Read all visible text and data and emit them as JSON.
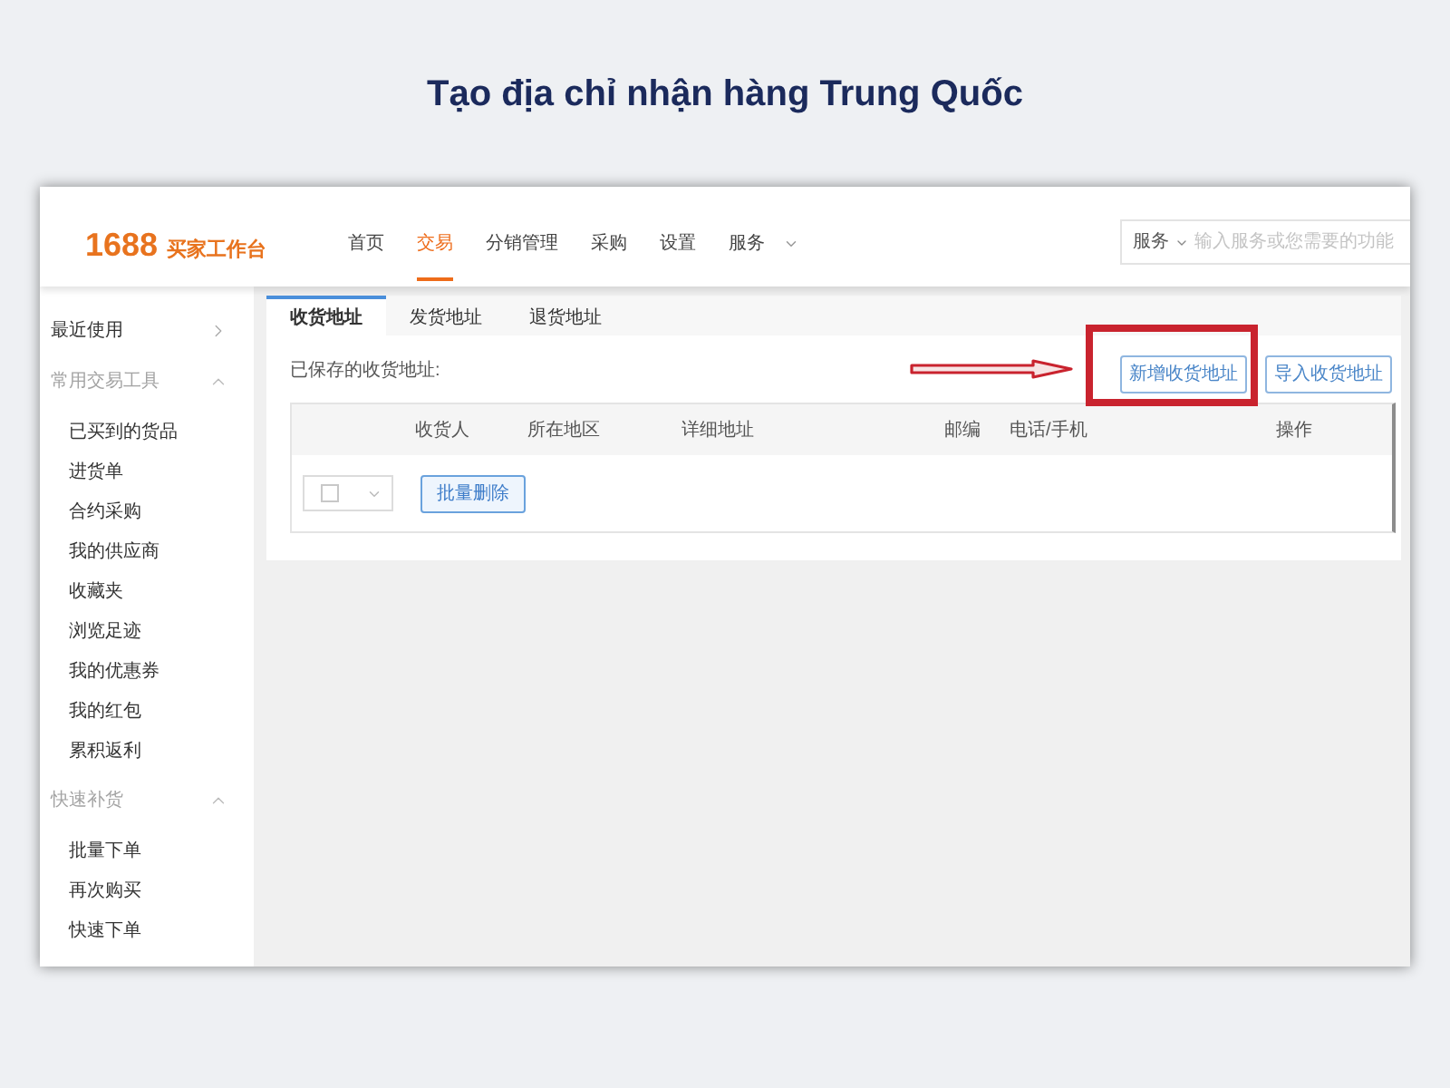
{
  "heading": "Tạo địa chỉ nhận hàng Trung Quốc",
  "header": {
    "logo_number": "1688",
    "logo_text": "买家工作台",
    "nav": [
      {
        "label": "首页",
        "selected": false,
        "kind": "link"
      },
      {
        "label": "交易",
        "selected": true,
        "kind": "link"
      },
      {
        "label": "分销管理",
        "selected": false,
        "kind": "link"
      },
      {
        "label": "采购",
        "selected": false,
        "kind": "link"
      },
      {
        "label": "设置",
        "selected": false,
        "kind": "link"
      },
      {
        "label": "服务",
        "selected": false,
        "kind": "dropdown"
      }
    ],
    "search": {
      "scope": "服务",
      "placeholder": "输入服务或您需要的功能"
    }
  },
  "sidebar": {
    "sections": [
      {
        "label": "最近使用",
        "kind": "link"
      },
      {
        "label": "常用交易工具",
        "kind": "group",
        "expanded": true,
        "children": [
          {
            "label": "已买到的货品"
          },
          {
            "label": "进货单"
          },
          {
            "label": "合约采购"
          },
          {
            "label": "我的供应商"
          },
          {
            "label": "收藏夹"
          },
          {
            "label": "浏览足迹"
          },
          {
            "label": "我的优惠券"
          },
          {
            "label": "我的红包"
          },
          {
            "label": "累积返利"
          }
        ]
      },
      {
        "label": "快速补货",
        "kind": "group",
        "expanded": true,
        "children": [
          {
            "label": "批量下单"
          },
          {
            "label": "再次购买"
          },
          {
            "label": "快速下单"
          }
        ]
      }
    ]
  },
  "tabs": [
    {
      "label": "收货地址",
      "selected": true
    },
    {
      "label": "发货地址",
      "selected": false
    },
    {
      "label": "退货地址",
      "selected": false
    }
  ],
  "saved_label": "已保存的收货地址:",
  "actions": [
    {
      "label": "新增收货地址",
      "highlighted": true
    },
    {
      "label": "导入收货地址",
      "highlighted": false
    }
  ],
  "table": {
    "columns": [
      "收货人",
      "所在地区",
      "详细地址",
      "邮编",
      "电话/手机",
      "操作"
    ],
    "select_all": {
      "checked": false
    },
    "bulk_action": "批量删除"
  }
}
